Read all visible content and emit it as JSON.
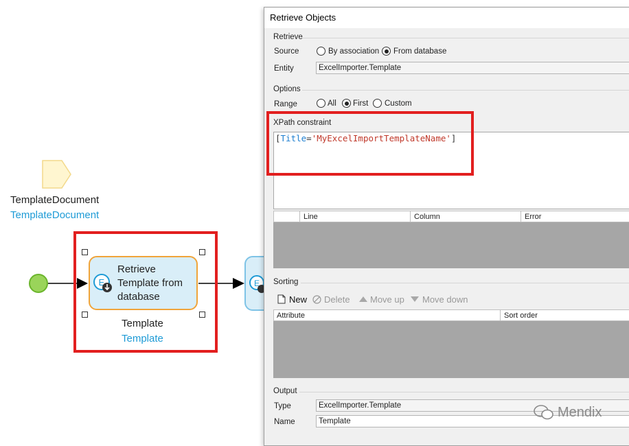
{
  "canvas": {
    "parameter": {
      "name": "TemplateDocument",
      "type": "TemplateDocument"
    },
    "activity": {
      "caption": "Retrieve Template from database",
      "output_name": "Template",
      "output_type": "Template"
    }
  },
  "dialog": {
    "title": "Retrieve Objects",
    "retrieve": {
      "group_label": "Retrieve",
      "source_label": "Source",
      "source_options": [
        "By association",
        "From database"
      ],
      "source_selected": "From database",
      "entity_label": "Entity",
      "entity_value": "ExcelImporter.Template"
    },
    "options": {
      "group_label": "Options",
      "range_label": "Range",
      "range_options": [
        "All",
        "First",
        "Custom"
      ],
      "range_selected": "First"
    },
    "xpath": {
      "group_label": "XPath constraint",
      "open": "[",
      "attr": "Title",
      "eq": "=",
      "value": "'MyExcelImportTemplateName'",
      "close": "]",
      "error_columns": [
        "Line",
        "Column",
        "Error"
      ]
    },
    "sorting": {
      "group_label": "Sorting",
      "buttons": {
        "new": "New",
        "delete": "Delete",
        "move_up": "Move up",
        "move_down": "Move down"
      },
      "columns": [
        "Attribute",
        "Sort order"
      ]
    },
    "output": {
      "group_label": "Output",
      "type_label": "Type",
      "type_value": "ExcelImporter.Template",
      "name_label": "Name",
      "name_value": "Template"
    }
  },
  "watermark": "Mendix",
  "colors": {
    "highlight_red": "#e21f1f",
    "activity_border": "#f0a43a",
    "activity_fill": "#d9eef8",
    "type_blue": "#1e9bd6",
    "start_event": "#9ad45a"
  }
}
